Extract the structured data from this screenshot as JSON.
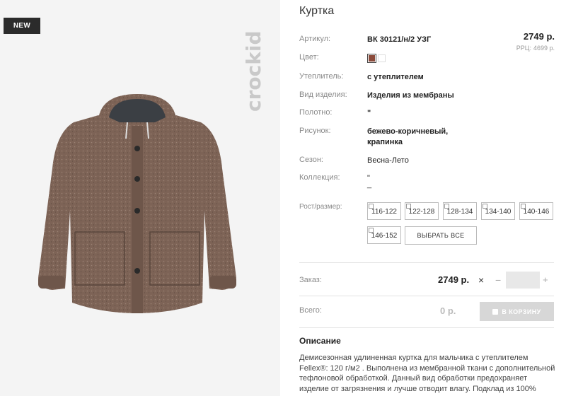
{
  "badge": "NEW",
  "brand": "crockid",
  "product": {
    "title": "Куртка",
    "price": "2749 р.",
    "rrp_label": "РРЦ:",
    "rrp_value": "4699 р.",
    "swatch_color": "#8b4a3a",
    "specs": [
      {
        "label": "Артикул:",
        "value": "ВК 30121/н/2 УЗГ"
      },
      {
        "label": "Цвет:",
        "value": ""
      },
      {
        "label": "Утеплитель:",
        "value": "с утеплителем"
      },
      {
        "label": "Вид изделия:",
        "value": "Изделия из мембраны"
      },
      {
        "label": "Полотно:",
        "value": "\""
      },
      {
        "label": "Рисунок:",
        "value": "бежево-коричневый,",
        "value2": "крапинка"
      },
      {
        "label": "Сезон:",
        "value": "Весна-Лето"
      },
      {
        "label": "Коллекция:",
        "value": "\"",
        "value2": "_"
      }
    ],
    "size_label": "Рост/размер:",
    "sizes": [
      "116-122",
      "122-128",
      "128-134",
      "134-140",
      "140-146",
      "146-152"
    ],
    "select_all": "ВЫБРАТЬ ВСЕ"
  },
  "order": {
    "label": "Заказ:",
    "price": "2749 р.",
    "remove_icon": "×",
    "minus": "−",
    "plus": "+",
    "quantity": ""
  },
  "total": {
    "label": "Всего:",
    "value": "0 р.",
    "cart_button": "В КОРЗИНУ"
  },
  "description": {
    "title": "Описание",
    "lines": [
      "Демисезонная удлиненная куртка для мальчика с утеплителем",
      "Fellex®: 120 г/м2 . Выполнена из мембранной ткани с дополнительной",
      "тефлоновой обработкой. Данный вид обработки предохраняет",
      "изделие от загрязнения и лучше отводит влагу. Подклад из 100%"
    ]
  }
}
